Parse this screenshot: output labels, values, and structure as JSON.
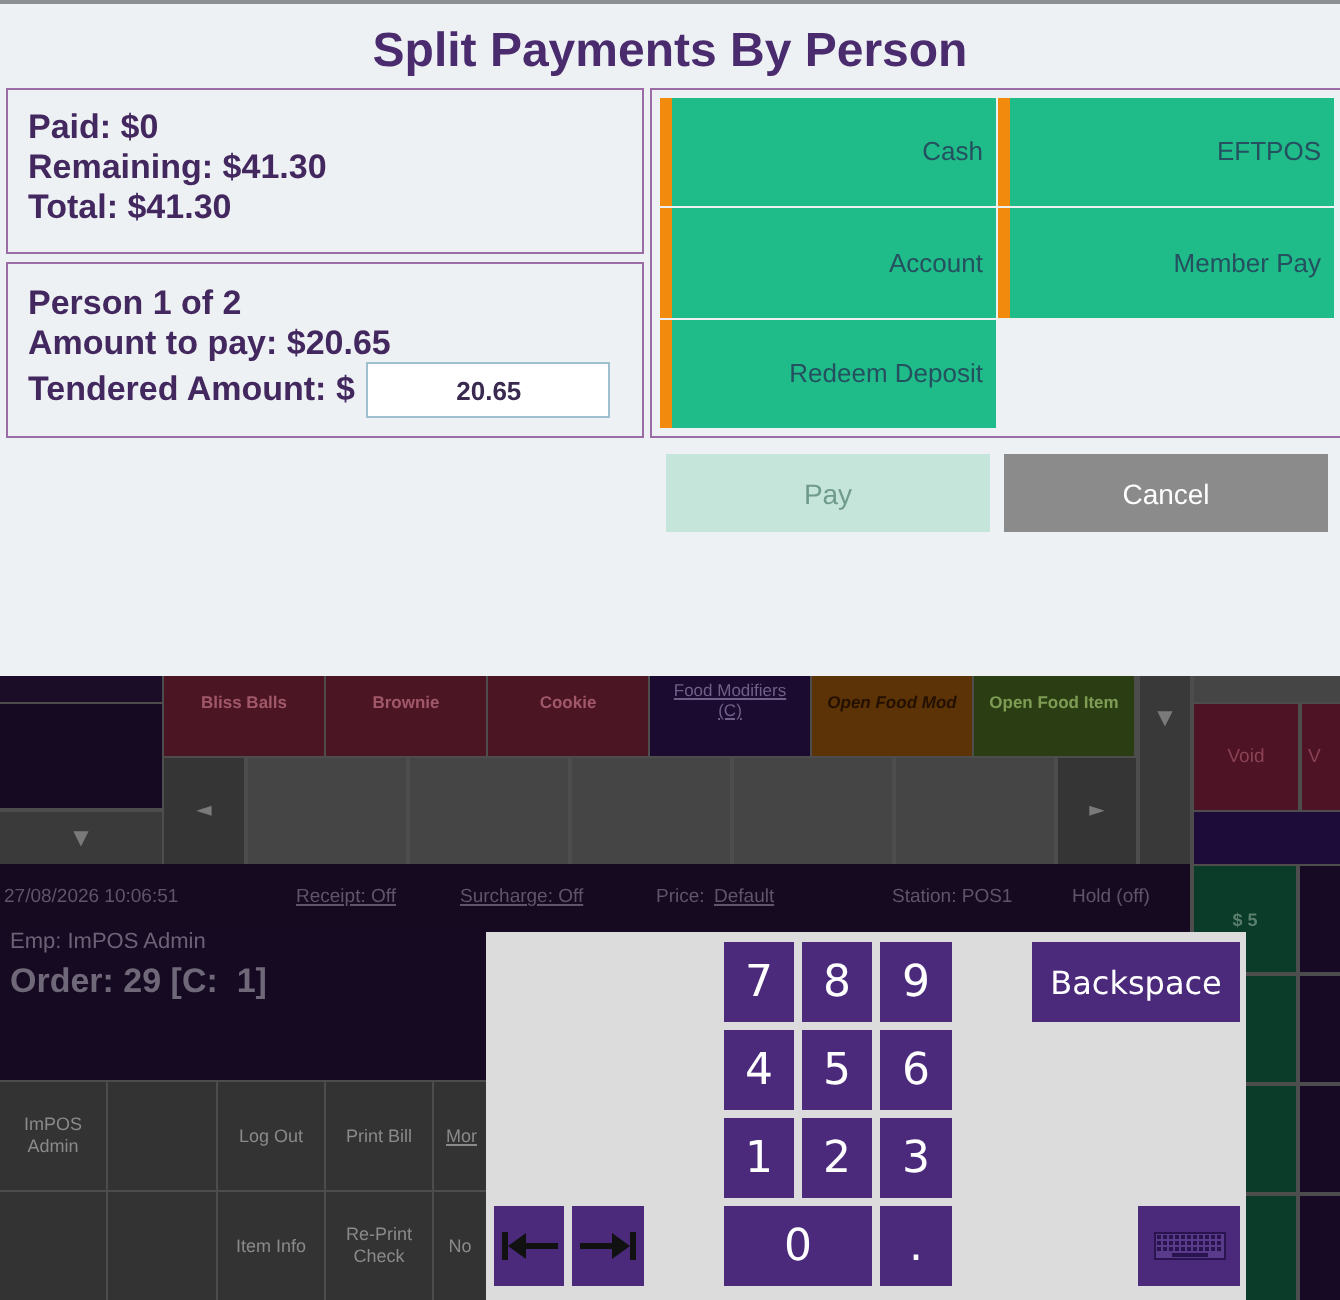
{
  "dialog": {
    "title": "Split Payments By Person",
    "summary": [
      "Paid: $0",
      "Remaining: $41.30",
      "Total: $41.30"
    ],
    "person": {
      "heading": "Person 1 of 2",
      "amount_to_pay": "Amount to pay: $20.65",
      "tendered_label": "Tendered Amount: $",
      "tendered_value": "20.65"
    },
    "payment_methods": [
      {
        "label": "Cash"
      },
      {
        "label": "EFTPOS"
      },
      {
        "label": "Account"
      },
      {
        "label": "Member Pay"
      },
      {
        "label": "Redeem Deposit"
      }
    ],
    "actions": [
      {
        "label": "Pay",
        "kind": "primary",
        "disabled": true
      },
      {
        "label": "Cancel",
        "kind": "secondary",
        "disabled": false
      }
    ]
  },
  "pos": {
    "category_scroll": "▼",
    "item_scroll": "▼",
    "page_prev": "◄",
    "page_next": "►",
    "menu_items": [
      {
        "label": "Bliss Balls",
        "kind": "item",
        "color": "#4b1524"
      },
      {
        "label": "Brownie",
        "kind": "item",
        "color": "#4b1524"
      },
      {
        "label": "Cookie",
        "kind": "item",
        "color": "#4b1524"
      },
      {
        "label": "Food Modifiers (C)",
        "kind": "group",
        "color": "#1c0b30"
      },
      {
        "label": "Open Food Mod",
        "kind": "open",
        "color": "#5c3306"
      },
      {
        "label": "Open Food Item",
        "kind": "item",
        "color": "#2b3e13"
      }
    ],
    "side_buttons": [
      {
        "label": "Void"
      },
      {
        "label": "V"
      }
    ],
    "status_bar": [
      {
        "text": "27/08/2026 10:06:51",
        "link": false
      },
      {
        "text": "Receipt: Off",
        "link": true
      },
      {
        "text": "Surcharge: Off",
        "link": true
      },
      {
        "text": "Price:",
        "link": false
      },
      {
        "text": "Default",
        "link": true
      },
      {
        "text": "Station: POS1",
        "link": false
      },
      {
        "text": "Hold (off)",
        "link": false
      }
    ],
    "order": {
      "employee": "Emp: ImPOS Admin",
      "number": "Order: 29 [C:  1]"
    },
    "quick_cash": [
      {
        "kind": "cash",
        "label": "$ 5"
      },
      {
        "kind": "blank"
      },
      {
        "kind": "blank"
      },
      {
        "kind": "blank"
      }
    ],
    "function_buttons": [
      [
        {
          "kind": "button",
          "label": "ImPOS Admin"
        },
        {
          "kind": "blank"
        },
        {
          "kind": "button",
          "label": "Log Out"
        },
        {
          "kind": "button",
          "label": "Print Bill"
        },
        {
          "kind": "link",
          "label": "Mor"
        }
      ],
      [
        {
          "kind": "blank"
        },
        {
          "kind": "blank"
        },
        {
          "kind": "button",
          "label": "Item Info"
        },
        {
          "kind": "button",
          "label": "Re-Print Check"
        },
        {
          "kind": "button",
          "label": "No"
        }
      ]
    ]
  },
  "keypad": {
    "keys": [
      {
        "label": "7",
        "wide": false
      },
      {
        "label": "8",
        "wide": false
      },
      {
        "label": "9",
        "wide": false
      },
      {
        "label": "4",
        "wide": false
      },
      {
        "label": "5",
        "wide": false
      },
      {
        "label": "6",
        "wide": false
      },
      {
        "label": "1",
        "wide": false
      },
      {
        "label": "2",
        "wide": false
      },
      {
        "label": "3",
        "wide": false
      },
      {
        "label": "0",
        "wide": true
      },
      {
        "label": ".",
        "wide": false
      }
    ],
    "backspace": "Backspace"
  }
}
